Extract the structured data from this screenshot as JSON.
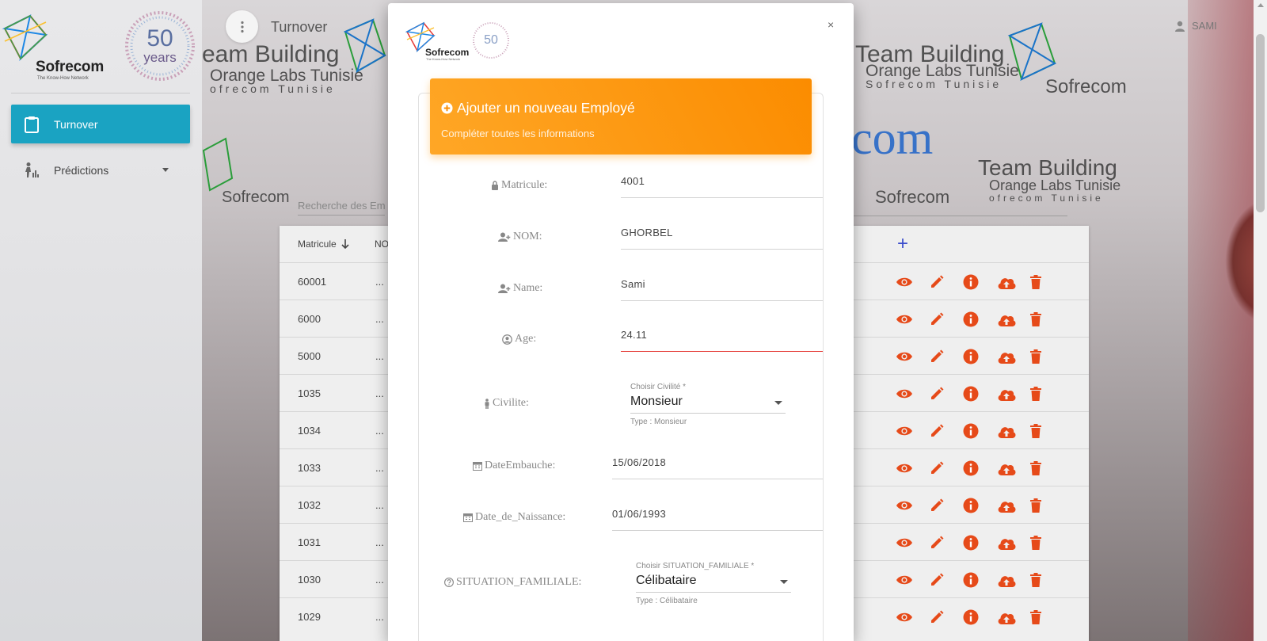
{
  "app": {
    "brand": "Sofrecom",
    "tagline": "The Know-How Network",
    "years_badge": "50",
    "years_word": "years"
  },
  "sidebar": {
    "items": [
      {
        "label": "Turnover",
        "icon": "clipboard-icon",
        "active": true
      },
      {
        "label": "Prédictions",
        "icon": "person-chart-icon",
        "active": false
      }
    ]
  },
  "header": {
    "title": "Turnover",
    "user": "SAMI"
  },
  "background": {
    "banner_1": "eam Building",
    "banner_1_sub": "Orange Labs Tunisie",
    "banner_1_sub2": "ofrecom Tunisie",
    "banner_2": "Team Building",
    "banner_2_sub": "Orange Labs Tunisie",
    "banner_2_sub2": "Sofrecom Tunisie",
    "banner_3": "Team Building",
    "banner_3_sub": "Orange Labs Tunisie",
    "banner_3_sub2": "ofrecom Tunisie",
    "brand_big": "com",
    "brand_a": "Sofrecom",
    "brand_b": "Sofrecom",
    "brand_c": "Sofrecom"
  },
  "search": {
    "placeholder": "Recherche des Em"
  },
  "table": {
    "columns": [
      "Matricule",
      "NO"
    ],
    "add_label": "+",
    "rows": [
      {
        "matricule": "60001",
        "nom": "..."
      },
      {
        "matricule": "6000",
        "nom": "..."
      },
      {
        "matricule": "5000",
        "nom": "..."
      },
      {
        "matricule": "1035",
        "nom": "..."
      },
      {
        "matricule": "1034",
        "nom": "..."
      },
      {
        "matricule": "1033",
        "nom": "..."
      },
      {
        "matricule": "1032",
        "nom": "..."
      },
      {
        "matricule": "1031",
        "nom": "..."
      },
      {
        "matricule": "1030",
        "nom": "..."
      },
      {
        "matricule": "1029",
        "nom": "..."
      }
    ],
    "action_icons": [
      "eye-icon",
      "edit-pencil-icon",
      "info-icon",
      "cloud-upload-icon",
      "trash-icon"
    ],
    "action_color": "#e64a19"
  },
  "modal": {
    "close_label": "×",
    "brand": "Sofrecom",
    "tagline": "The Know-How Network",
    "years_badge": "50",
    "header_title": "Ajouter un nouveau Employé",
    "header_subtitle": "Compléter toutes les informations",
    "header_color": "#fb8c00",
    "fields": {
      "matricule": {
        "label": "Matricule:",
        "value": "4001"
      },
      "nom": {
        "label": "NOM:",
        "value": "GHORBEL"
      },
      "name": {
        "label": "Name:",
        "value": "Sami"
      },
      "age": {
        "label": "Age:",
        "value": "24.11"
      },
      "civilite": {
        "label": "Civilite:",
        "float": "Choisir Civilité *",
        "value": "Monsieur",
        "hint": "Type : Monsieur"
      },
      "date_embauche": {
        "label": "DateEmbauche:",
        "value": "15/06/2018"
      },
      "date_naissance": {
        "label": "Date_de_Naissance:",
        "value": "01/06/1993"
      },
      "situation": {
        "label": "SITUATION_FAMILIALE:",
        "float": "Choisir SITUATION_FAMILIALE *",
        "value": "Célibataire",
        "hint": "Type : Célibataire"
      }
    }
  }
}
